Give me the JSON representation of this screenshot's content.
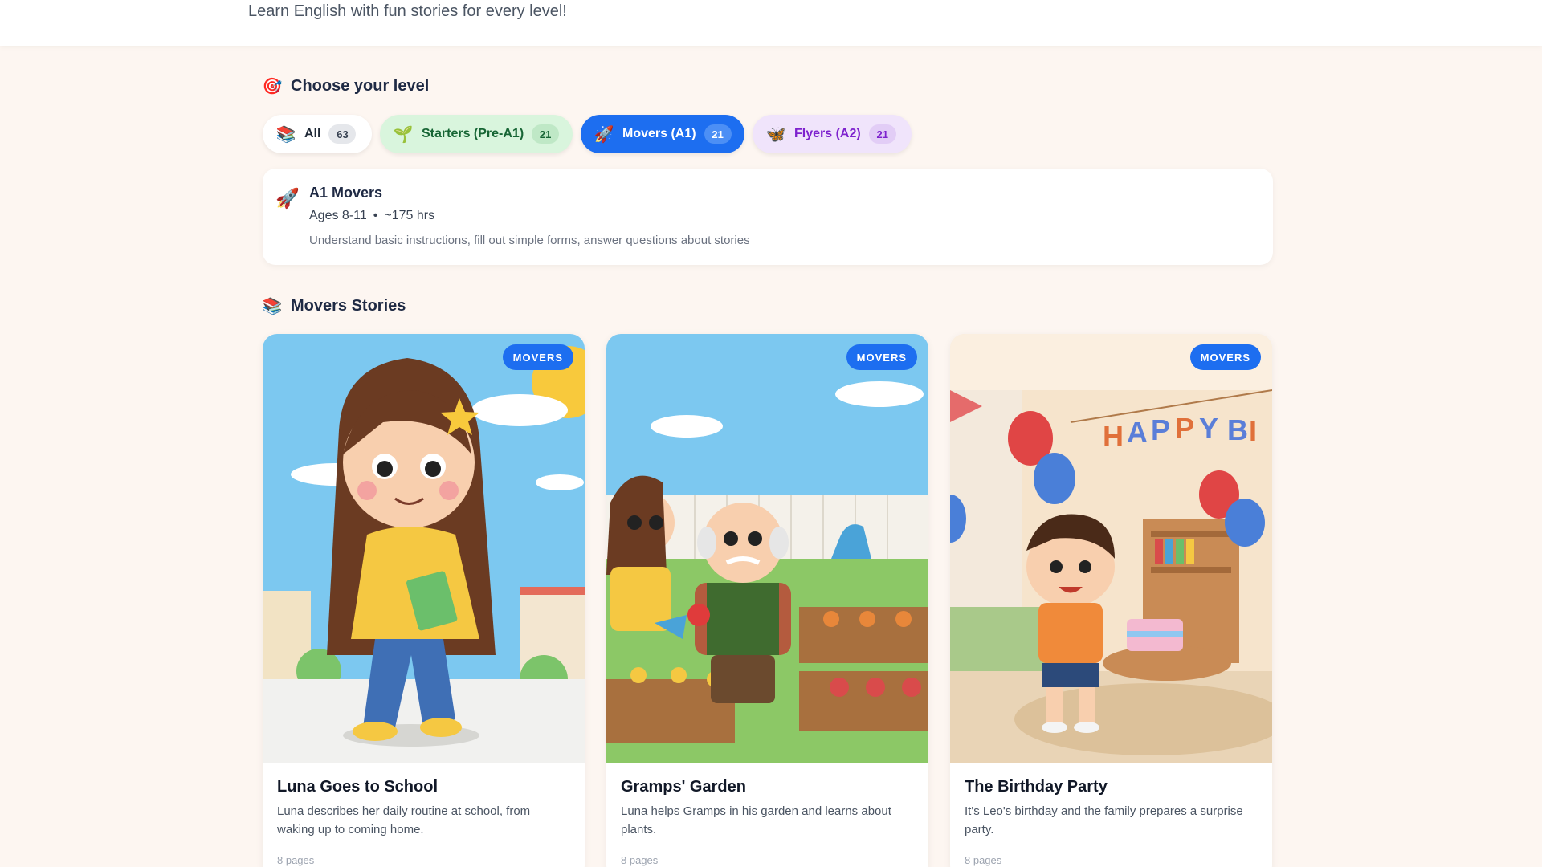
{
  "header": {
    "subtitle": "Learn English with fun stories for every level!"
  },
  "level_section": {
    "title": "Choose your level",
    "icon": "target-icon",
    "pills": [
      {
        "label": "All",
        "count": "63",
        "icon": "books-icon",
        "selected": false
      },
      {
        "label": "Starters (Pre-A1)",
        "count": "21",
        "icon": "seedling-icon",
        "selected": false
      },
      {
        "label": "Movers (A1)",
        "count": "21",
        "icon": "rocket-icon",
        "selected": true
      },
      {
        "label": "Flyers (A2)",
        "count": "21",
        "icon": "butterfly-icon",
        "selected": false
      }
    ]
  },
  "level_info": {
    "name": "A1 Movers",
    "ages": "Ages 8-11",
    "separator": "•",
    "hours": "~175 hrs",
    "description": "Understand basic instructions, fill out simple forms, answer questions about stories"
  },
  "stories_section": {
    "title": "Movers Stories",
    "icon": "books-icon",
    "cards": [
      {
        "badge": "MOVERS",
        "title": "Luna Goes to School",
        "description": "Luna describes her daily routine at school, from waking up to coming home.",
        "pages": "8 pages"
      },
      {
        "badge": "MOVERS",
        "title": "Gramps' Garden",
        "description": "Luna helps Gramps in his garden and learns about plants.",
        "pages": "8 pages"
      },
      {
        "badge": "MOVERS",
        "title": "The Birthday Party",
        "description": "It's Leo's birthday and the family prepares a surprise party.",
        "pages": "8 pages"
      }
    ]
  },
  "colors": {
    "accent": "#1d6ef0",
    "background": "#fdf6f1",
    "starters": "#d9f5dd",
    "flyers": "#f0e4fb"
  }
}
